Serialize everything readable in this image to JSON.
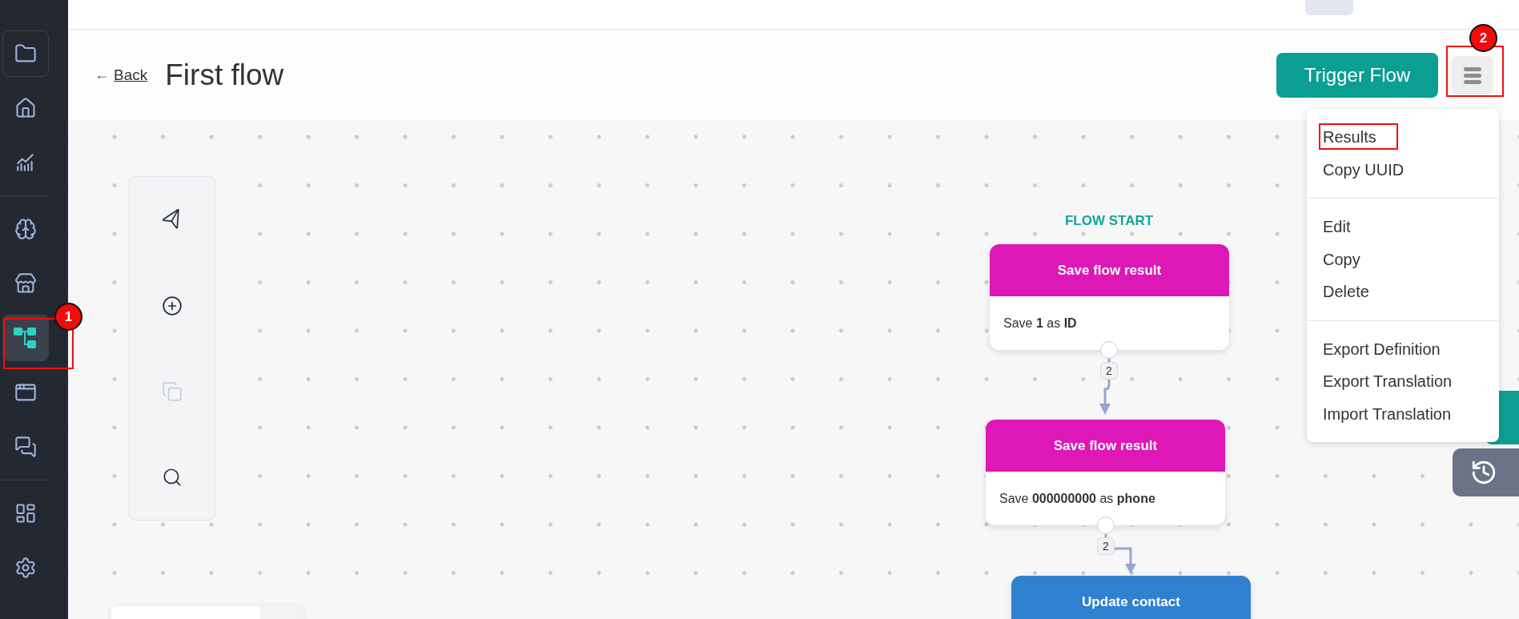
{
  "sidebar": {
    "sections": [
      {
        "items": [
          {
            "kind": "folder",
            "selected": false,
            "boxed": true
          },
          {
            "kind": "home",
            "selected": false,
            "boxed": false
          },
          {
            "kind": "analytics",
            "selected": false,
            "boxed": false
          }
        ]
      },
      {
        "items": [
          {
            "kind": "brain",
            "selected": false,
            "boxed": false
          },
          {
            "kind": "store",
            "selected": false,
            "boxed": false
          },
          {
            "kind": "flows",
            "selected": true,
            "boxed": false
          },
          {
            "kind": "window",
            "selected": false,
            "boxed": false
          },
          {
            "kind": "chat",
            "selected": false,
            "boxed": false
          }
        ]
      },
      {
        "items": [
          {
            "kind": "dashboard",
            "selected": false,
            "boxed": false
          },
          {
            "kind": "settings",
            "selected": false,
            "boxed": false
          }
        ]
      }
    ]
  },
  "header": {
    "back_arrow": "←",
    "back": "Back",
    "title": "First flow",
    "primary_button": "Trigger Flow"
  },
  "tools": [
    {
      "kind": "send",
      "disabled": false
    },
    {
      "kind": "add",
      "disabled": false
    },
    {
      "kind": "copy",
      "disabled": true
    },
    {
      "kind": "search",
      "disabled": false
    }
  ],
  "flow_start": "FLOW START",
  "nodes": [
    {
      "title": "Save flow result",
      "color": "#dd18b6",
      "body": "Save **1** as **ID**",
      "exit_count": "2"
    },
    {
      "title": "Save flow result",
      "color": "#dd18b6",
      "body": "Save **000000000** as **phone**",
      "exit_count": "2"
    },
    {
      "title": "Update contact",
      "color": "#3080d0"
    }
  ],
  "menu": {
    "groups": [
      [
        "Results",
        "Copy UUID"
      ],
      [
        "Edit",
        "Copy",
        "Delete"
      ],
      [
        "Export Definition",
        "Export Translation",
        "Import Translation"
      ]
    ]
  },
  "annotations": [
    {
      "label": "1"
    },
    {
      "label": "2"
    }
  ]
}
